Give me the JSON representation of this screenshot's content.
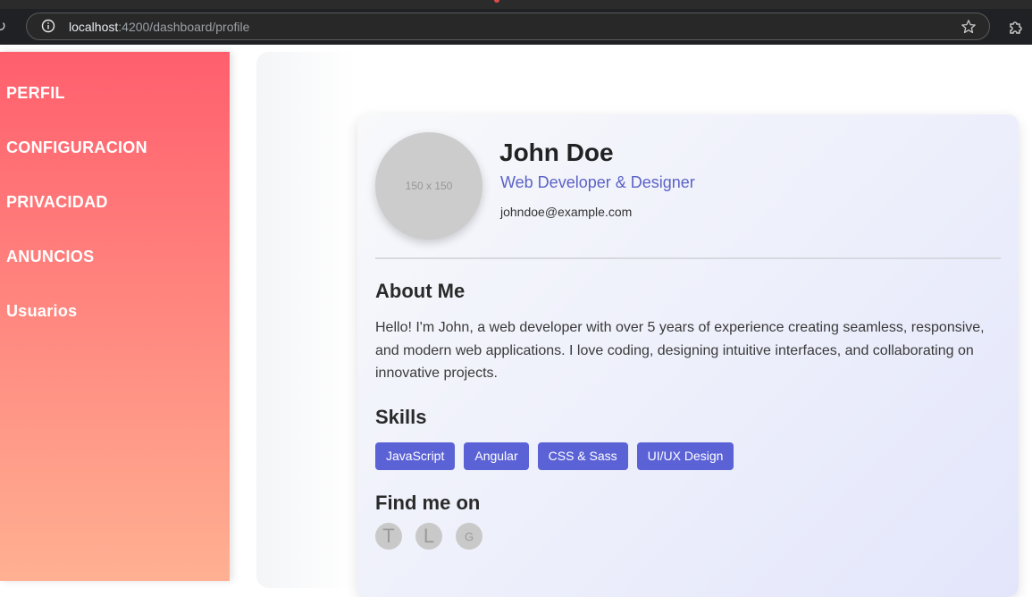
{
  "browser": {
    "url_host": "localhost",
    "url_path": ":4200/dashboard/profile",
    "reload_icon": "reload-icon",
    "info_icon": "info-icon",
    "star_icon": "star-icon",
    "extensions_icon": "puzzle-icon"
  },
  "sidebar": {
    "items": [
      {
        "label": "PERFIL"
      },
      {
        "label": "CONFIGURACION"
      },
      {
        "label": "PRIVACIDAD"
      },
      {
        "label": "ANUNCIOS"
      },
      {
        "label": "Usuarios"
      }
    ],
    "gradient_top": "#ff5f6d",
    "gradient_bottom": "#ffb092"
  },
  "profile": {
    "avatar_text": "150 x 150",
    "name": "John Doe",
    "role": "Web Developer & Designer",
    "email": "johndoe@example.com",
    "about_heading": "About Me",
    "about_text": "Hello! I'm John, a web developer with over 5 years of experience creating seamless, responsive, and modern web applications. I love coding, designing intuitive interfaces, and collaborating on innovative projects.",
    "skills_heading": "Skills",
    "skills": [
      "JavaScript",
      "Angular",
      "CSS & Sass",
      "UI/UX Design"
    ],
    "find_heading": "Find me on",
    "socials": [
      {
        "letter": "T",
        "icon": "twitter-icon"
      },
      {
        "letter": "L",
        "icon": "linkedin-icon"
      },
      {
        "letter": "G",
        "icon": "github-icon"
      }
    ],
    "accent_color": "#5b62d6"
  }
}
